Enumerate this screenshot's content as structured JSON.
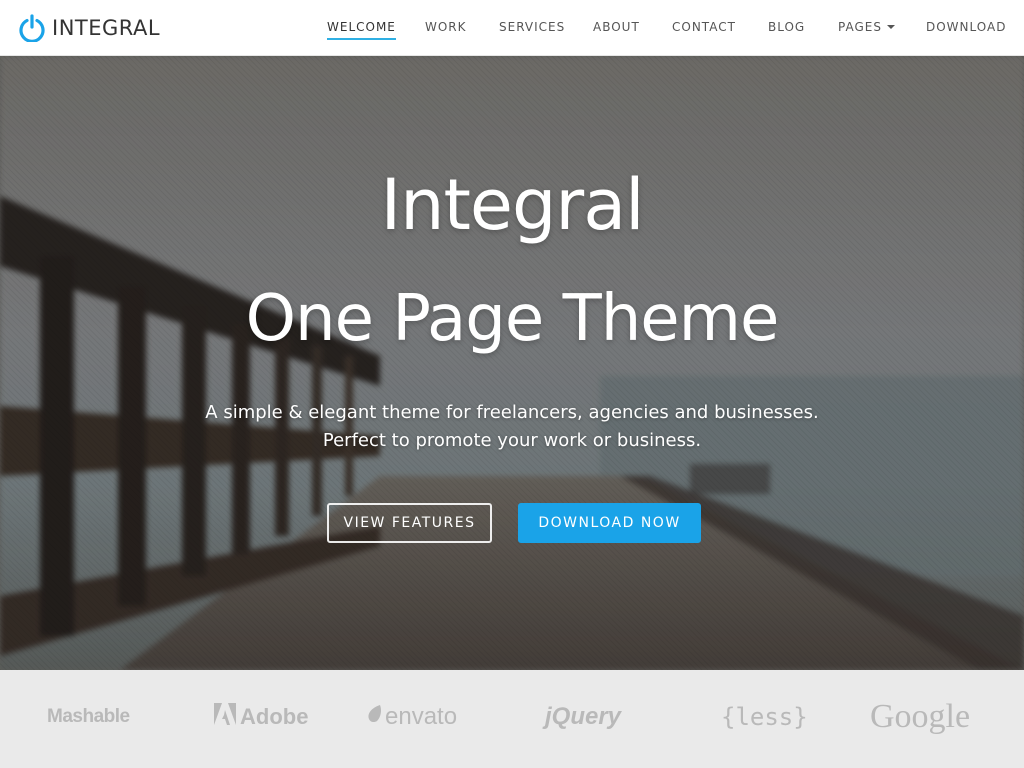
{
  "brand": {
    "name": "INTEGRAL",
    "icon": "power-icon",
    "accent_color": "#1aa3e8"
  },
  "nav": {
    "items": [
      {
        "label": "WELCOME",
        "active": true
      },
      {
        "label": "WORK"
      },
      {
        "label": "SERVICES"
      },
      {
        "label": "ABOUT"
      },
      {
        "label": "CONTACT"
      },
      {
        "label": "BLOG"
      },
      {
        "label": "PAGES",
        "dropdown": true
      },
      {
        "label": "DOWNLOAD"
      }
    ]
  },
  "hero": {
    "title_line1": "Integral",
    "title_line2": "One Page Theme",
    "subtitle_line1": "A simple & elegant theme for freelancers, agencies and businesses.",
    "subtitle_line2": "Perfect to promote your work or business.",
    "buttons": {
      "secondary": "VIEW FEATURES",
      "primary": "DOWNLOAD NOW"
    },
    "primary_button_color": "#1aa3e8"
  },
  "partners": [
    {
      "name": "Mashable"
    },
    {
      "name": "Adobe",
      "icon": "adobe-icon"
    },
    {
      "name": "envato",
      "icon": "envato-leaf-icon"
    },
    {
      "name": "jQuery"
    },
    {
      "name": "{less}"
    },
    {
      "name": "Google"
    }
  ]
}
